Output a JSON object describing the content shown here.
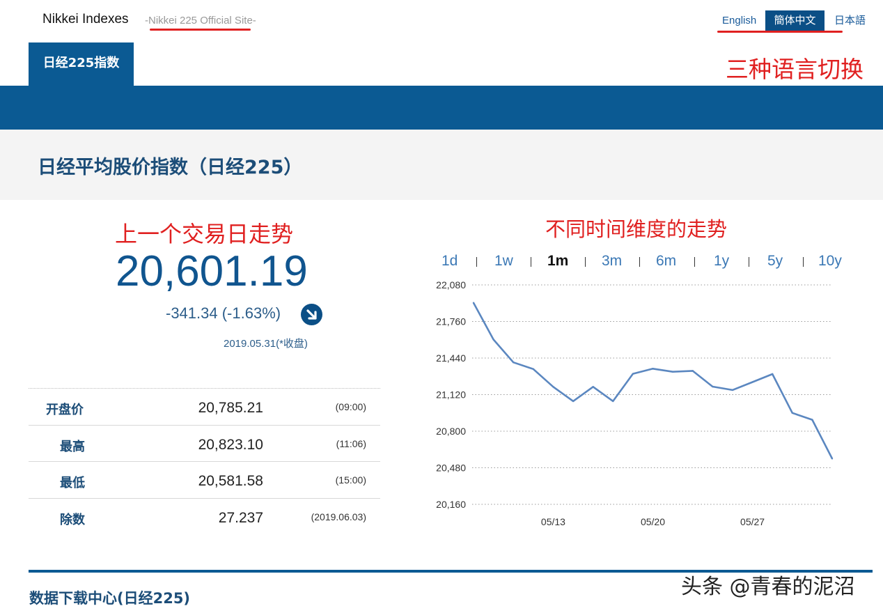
{
  "header": {
    "brand": "Nikkei Indexes",
    "subtitle": "-Nikkei 225 Official Site-",
    "languages": [
      "English",
      "簡体中文",
      "日本語"
    ],
    "active_language": "簡体中文"
  },
  "annotations": {
    "lang_note": "三种语言切换",
    "prev_day_note": "上一个交易日走势",
    "timeframe_note": "不同时间维度的走势"
  },
  "colors": {
    "primary": "#0b5a93",
    "title": "#1c4d78",
    "annotation": "#e02020",
    "line": "#5b87c0"
  },
  "nav": {
    "tab_label": "日经225指数"
  },
  "page": {
    "title": "日经平均股价指数（日经225）"
  },
  "summary": {
    "value": "20,601.19",
    "change": "-341.34 (-1.63%)",
    "direction_icon": "down-arrow-circle-icon",
    "date": "2019.05.31(*收盘)"
  },
  "stats": [
    {
      "label": "开盘价",
      "value": "20,785.21",
      "time": "(09:00)"
    },
    {
      "label": "最高",
      "value": "20,823.10",
      "time": "(11:06)"
    },
    {
      "label": "最低",
      "value": "20,581.58",
      "time": "(15:00)"
    },
    {
      "label": "除数",
      "value": "27.237",
      "time": "(2019.06.03)"
    }
  ],
  "timeframes": [
    "1d",
    "1w",
    "1m",
    "3m",
    "6m",
    "1y",
    "5y",
    "10y"
  ],
  "active_timeframe": "1m",
  "chart_data": {
    "type": "line",
    "yticks": [
      "22,080",
      "21,760",
      "21,440",
      "21,120",
      "20,800",
      "20,480",
      "20,160"
    ],
    "ylim": [
      20160,
      22080
    ],
    "xticks": [
      {
        "label": "05/13",
        "index": 4
      },
      {
        "label": "05/20",
        "index": 9
      },
      {
        "label": "05/27",
        "index": 14
      }
    ],
    "grid": true,
    "series": [
      {
        "values": [
          21923,
          21602,
          21402,
          21344,
          21188,
          21063,
          21188,
          21063,
          21302,
          21347,
          21320,
          21328,
          21190,
          21160,
          21230,
          21300,
          20960,
          20900,
          20560
        ]
      }
    ]
  },
  "footer": {
    "section_title": "数据下载中心(日经225)",
    "watermark": "头条 @青春的泥沼"
  }
}
